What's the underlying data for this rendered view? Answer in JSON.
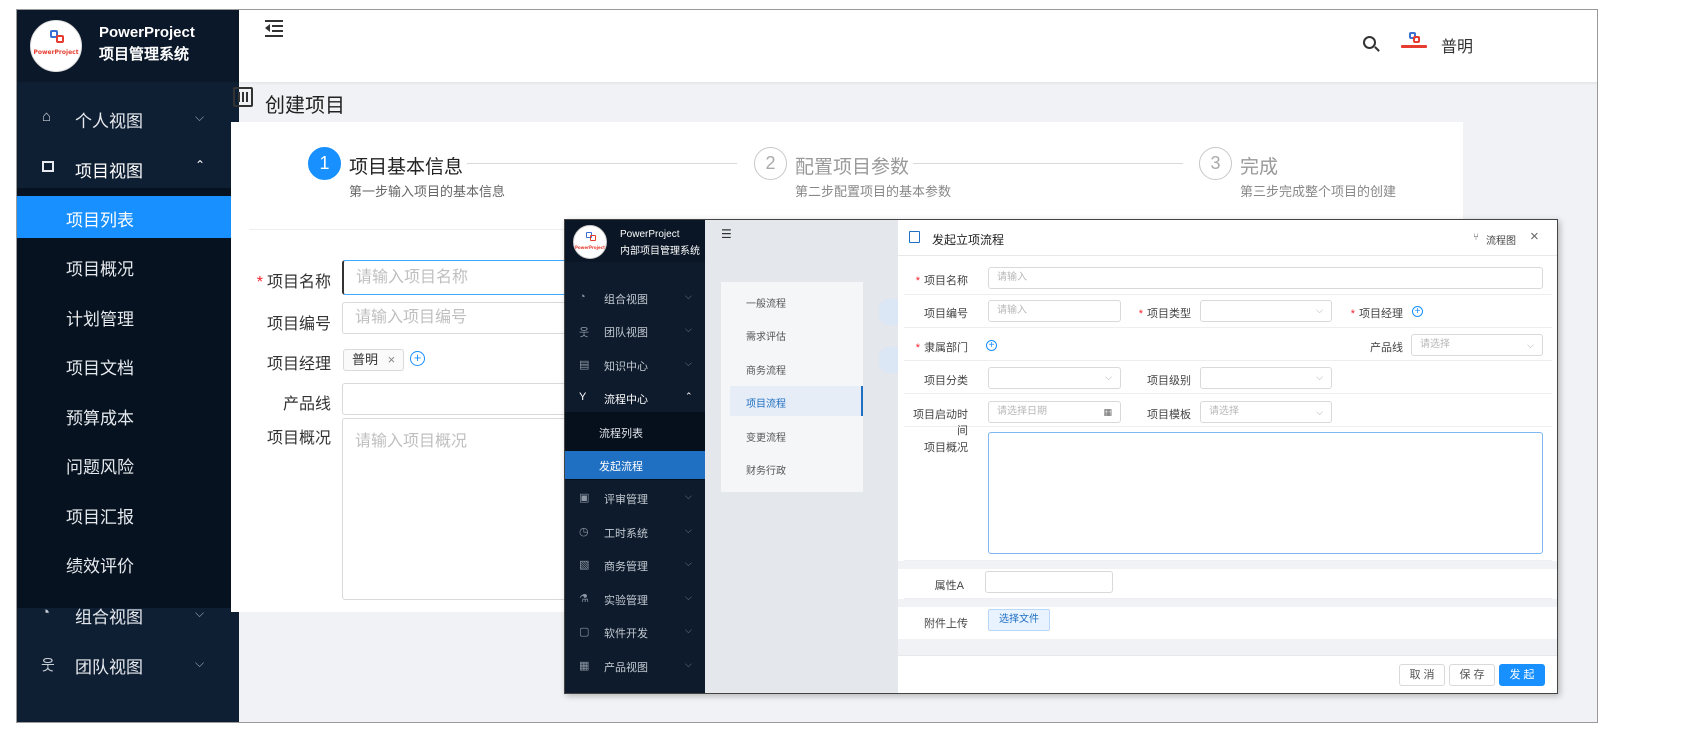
{
  "win1": {
    "brand": {
      "logo_text": "PowerProject",
      "name": "PowerProject",
      "subtitle": "项目管理系统"
    },
    "menu_toggle_icon": "menu-fold-icon",
    "nav": [
      {
        "label": "个人视图",
        "icon": "home-icon"
      },
      {
        "label": "项目视图",
        "icon": "project-icon"
      },
      {
        "label": "组合视图",
        "icon": "dashboard-icon"
      },
      {
        "label": "团队视图",
        "icon": "team-icon"
      }
    ],
    "subnav": [
      "项目列表",
      "项目概况",
      "计划管理",
      "项目文档",
      "预算成本",
      "问题风险",
      "项目汇报",
      "绩效评价"
    ],
    "header": {
      "user_name": "普明"
    },
    "page_title": "创建项目",
    "steps": [
      {
        "num": "1",
        "title": "项目基本信息",
        "desc": "第一步输入项目的基本信息"
      },
      {
        "num": "2",
        "title": "配置项目参数",
        "desc": "第二步配置项目的基本参数"
      },
      {
        "num": "3",
        "title": "完成",
        "desc": "第三步完成整个项目的创建"
      }
    ],
    "form": {
      "name_label": "项目名称",
      "name_placeholder": "请输入项目名称",
      "code_label": "项目编号",
      "code_placeholder": "请输入项目编号",
      "manager_label": "项目经理",
      "manager_tag": "普明",
      "line_label": "产品线",
      "overview_label": "项目概况",
      "overview_placeholder": "请输入项目概况"
    },
    "colors": {
      "sidebar": "#0f1f33",
      "active": "#1890ff"
    }
  },
  "win2": {
    "brand": {
      "name": "PowerProject",
      "subtitle": "内部项目管理系统"
    },
    "nav": [
      {
        "label": "组合视图",
        "icon": "dashboard-icon"
      },
      {
        "label": "团队视图",
        "icon": "team-icon"
      },
      {
        "label": "知识中心",
        "icon": "book-icon"
      },
      {
        "label": "流程中心",
        "icon": "flow-icon"
      },
      {
        "label": "流程列表"
      },
      {
        "label": "发起流程"
      },
      {
        "label": "评审管理",
        "icon": "review-icon"
      },
      {
        "label": "工时系统",
        "icon": "clock-icon"
      },
      {
        "label": "商务管理",
        "icon": "business-icon"
      },
      {
        "label": "实验管理",
        "icon": "lab-icon"
      },
      {
        "label": "软件开发",
        "icon": "code-icon"
      },
      {
        "label": "产品视图",
        "icon": "product-icon"
      }
    ],
    "flow_types": [
      "一般流程",
      "需求评估",
      "商务流程",
      "项目流程",
      "变更流程",
      "财务行政"
    ],
    "dialog": {
      "title": "发起立项流程",
      "flowchart_link": "流程图",
      "fields": {
        "name_label": "项目名称",
        "name_placeholder": "请输入",
        "code_label": "项目编号",
        "code_placeholder": "请输入",
        "type_label": "项目类型",
        "manager_label": "项目经理",
        "dept_label": "隶属部门",
        "line_label": "产品线",
        "line_placeholder": "请选择",
        "category_label": "项目分类",
        "level_label": "项目级别",
        "start_label": "项目启动时间",
        "start_placeholder": "请选择日期",
        "template_label": "项目模板",
        "template_placeholder": "请选择",
        "overview_label": "项目概况",
        "attr_label": "属性A",
        "upload_label": "附件上传",
        "upload_button": "选择文件"
      },
      "buttons": {
        "cancel": "取 消",
        "save": "保 存",
        "submit": "发 起"
      }
    }
  }
}
